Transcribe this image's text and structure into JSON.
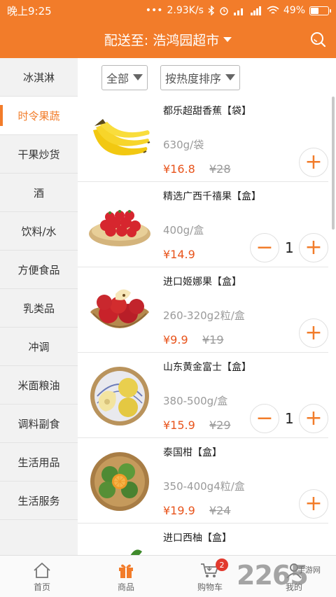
{
  "status": {
    "time": "晚上9:25",
    "dots": "•••",
    "speed": "2.93K/s",
    "battery": "49%",
    "battery_fraction": 0.49
  },
  "header": {
    "prefix": "配送至:",
    "store": "浩鸿园超市"
  },
  "sidebar": {
    "items": [
      {
        "label": "冰淇淋",
        "active": false
      },
      {
        "label": "时令果蔬",
        "active": true
      },
      {
        "label": "干果炒货",
        "active": false
      },
      {
        "label": "酒",
        "active": false
      },
      {
        "label": "饮料/水",
        "active": false
      },
      {
        "label": "方便食品",
        "active": false
      },
      {
        "label": "乳类品",
        "active": false
      },
      {
        "label": "冲调",
        "active": false
      },
      {
        "label": "米面粮油",
        "active": false
      },
      {
        "label": "调料副食",
        "active": false
      },
      {
        "label": "生活用品",
        "active": false
      },
      {
        "label": "生活服务",
        "active": false
      }
    ]
  },
  "filters": {
    "category": "全部",
    "sort": "按热度排序"
  },
  "products": [
    {
      "name": "都乐超甜香蕉【袋】",
      "spec": "630g/袋",
      "price": "¥16.8",
      "old_price": "¥28",
      "qty": "",
      "image": "banana"
    },
    {
      "name": "精选广西千禧果【盒】",
      "spec": "400g/盒",
      "price": "¥14.9",
      "old_price": "",
      "qty": "1",
      "image": "cherry-tomato"
    },
    {
      "name": "进口姬娜果【盒】",
      "spec": "260-320g2粒/盒",
      "price": "¥9.9",
      "old_price": "¥19",
      "qty": "",
      "image": "red-apple"
    },
    {
      "name": "山东黄金富士【盒】",
      "spec": "380-500g/盒",
      "price": "¥15.9",
      "old_price": "¥29",
      "qty": "1",
      "image": "yellow-apple"
    },
    {
      "name": "泰国柑【盒】",
      "spec": "350-400g4粒/盒",
      "price": "¥19.9",
      "old_price": "¥24",
      "qty": "",
      "image": "mandarin"
    },
    {
      "name": "进口西柚【盒】",
      "spec": "",
      "price": "",
      "old_price": "",
      "qty": "",
      "image": "grapefruit"
    }
  ],
  "buttons": {
    "plus": "+",
    "minus": "−"
  },
  "tabbar": {
    "tabs": [
      {
        "label": "首页",
        "icon": "home-icon"
      },
      {
        "label": "商品",
        "icon": "gift-icon"
      },
      {
        "label": "购物车",
        "icon": "cart-icon",
        "badge": "2"
      },
      {
        "label": "我的",
        "icon": "user-icon"
      }
    ]
  },
  "watermark": {
    "brand": "2265",
    "site": "手游网"
  },
  "colors": {
    "accent": "#f27c2a",
    "price": "#e8541c",
    "badge": "#e23a2e"
  }
}
